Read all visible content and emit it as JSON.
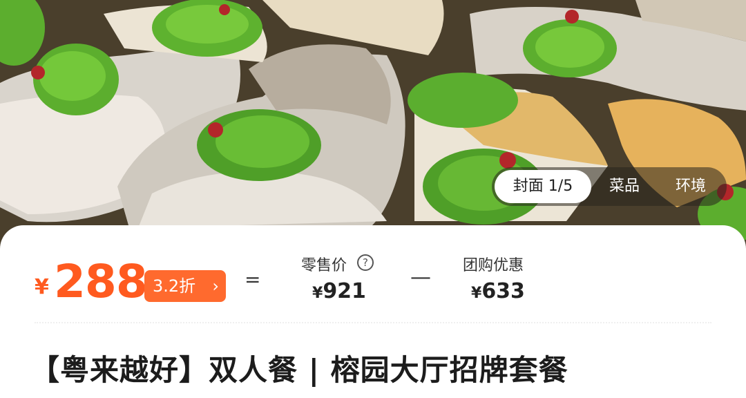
{
  "gallery": {
    "tabs": [
      {
        "label": "封面 1/5",
        "active": true
      },
      {
        "label": "菜品",
        "active": false
      },
      {
        "label": "环境",
        "active": false
      }
    ]
  },
  "price": {
    "currency": "¥",
    "value": "288",
    "discount": "3.2折",
    "equals": "=",
    "minus": "—",
    "retail_label": "零售价",
    "retail_currency": "¥",
    "retail_value": "921",
    "group_label": "团购优惠",
    "group_currency": "¥",
    "group_value": "633"
  },
  "deal": {
    "title": "【粤来越好】双人餐 | 榕园大厅招牌套餐"
  },
  "colors": {
    "accent": "#ff5a1f",
    "badge": "#ff6a2e"
  },
  "icons": {
    "help": "question-circle-icon",
    "chevron": "chevron-right-icon"
  }
}
